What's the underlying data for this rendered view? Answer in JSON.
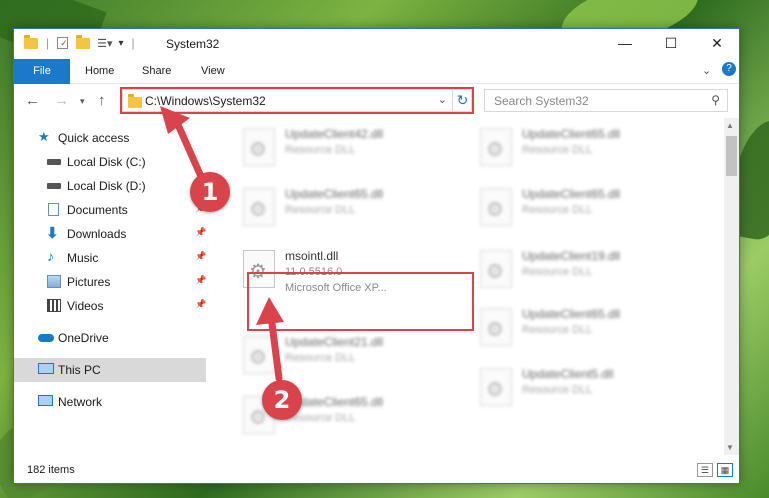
{
  "window": {
    "title": "System32",
    "controls": {
      "minimize": "—",
      "maximize": "☐",
      "close": "✕"
    }
  },
  "ribbon": {
    "tabs": [
      "File",
      "Home",
      "Share",
      "View"
    ]
  },
  "navigation": {
    "address_path": "C:\\Windows\\System32",
    "search_placeholder": "Search System32"
  },
  "sidebar": {
    "items": [
      {
        "label": "Quick access",
        "icon": "star-icon",
        "pinned": false
      },
      {
        "label": "Local Disk (C:)",
        "icon": "drive-icon",
        "pinned": false
      },
      {
        "label": "Local Disk (D:)",
        "icon": "drive-icon",
        "pinned": false
      },
      {
        "label": "Documents",
        "icon": "documents-icon",
        "pinned": true
      },
      {
        "label": "Downloads",
        "icon": "download-icon",
        "pinned": true
      },
      {
        "label": "Music",
        "icon": "music-icon",
        "pinned": true
      },
      {
        "label": "Pictures",
        "icon": "pictures-icon",
        "pinned": true
      },
      {
        "label": "Videos",
        "icon": "videos-icon",
        "pinned": true
      },
      {
        "label": "OneDrive",
        "icon": "cloud-icon",
        "pinned": false
      },
      {
        "label": "This PC",
        "icon": "computer-icon",
        "pinned": false,
        "selected": true
      },
      {
        "label": "Network",
        "icon": "network-icon",
        "pinned": false
      }
    ]
  },
  "files": {
    "left_column": [
      {
        "name": "UpdateClient42.dll",
        "type": "Resource DLL"
      },
      {
        "name": "UpdateClient65.dll",
        "type": "Resource DLL"
      },
      {
        "name": "msointl.dll",
        "version": "11.0.5516.0",
        "description": "Microsoft Office XP...",
        "highlighted": true
      },
      {
        "name": "UpdateClient21.dll",
        "type": "Resource DLL"
      },
      {
        "name": "UpdateClient65.dll",
        "type": "Resource DLL"
      }
    ],
    "right_column": [
      {
        "name": "UpdateClient65.dll",
        "type": "Resource DLL"
      },
      {
        "name": "UpdateClient65.dll",
        "type": "Resource DLL"
      },
      {
        "name": "UpdateClient19.dll",
        "type": "Resource DLL"
      },
      {
        "name": "UpdateClient65.dll",
        "type": "Resource DLL"
      },
      {
        "name": "UpdateClient5.dll",
        "type": "Resource DLL"
      }
    ]
  },
  "status": {
    "item_count": "182 items"
  },
  "annotations": {
    "step1": "1",
    "step2": "2",
    "color": "#d9434c"
  }
}
